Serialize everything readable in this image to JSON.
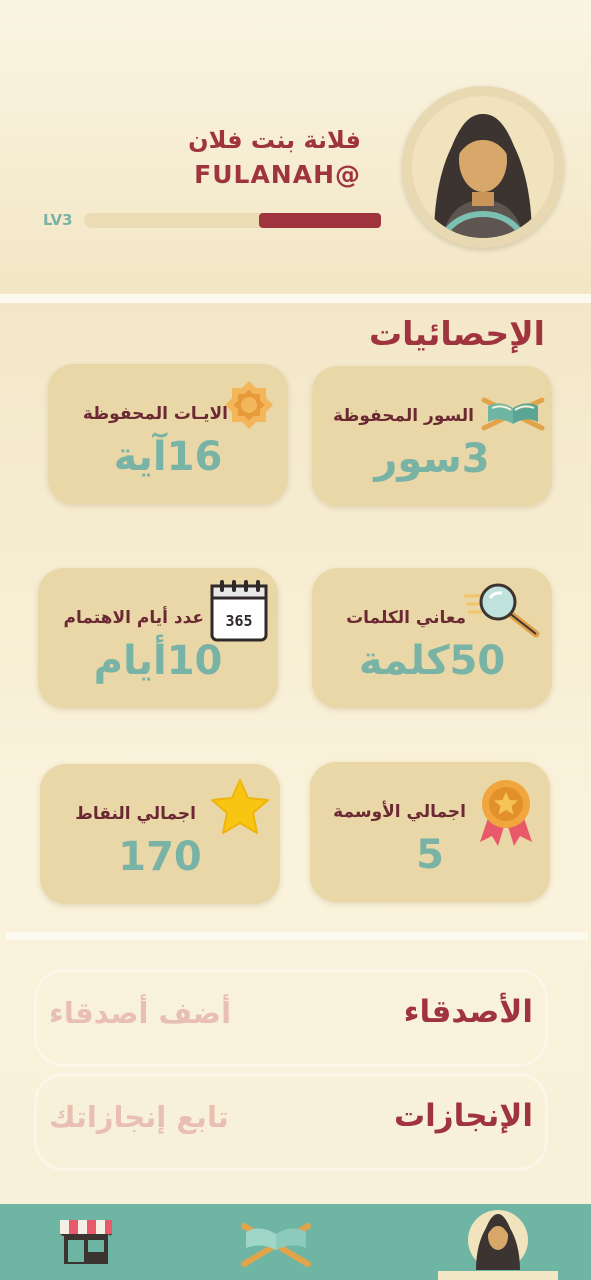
{
  "profile": {
    "name": "فلانة بنت فلان",
    "handle": "FULANAH@",
    "level_label": "LV3",
    "level_progress": 0.41
  },
  "stats": {
    "title": "الإحصائيات",
    "cards": [
      {
        "label": "السور المحفوظة",
        "value": "3سور",
        "icon": "open-quran-icon"
      },
      {
        "label": "الايـات المحفوظة",
        "value": "16آية",
        "icon": "eight-point-star-icon"
      },
      {
        "label": "معاني الكلمات",
        "value": "50كلمة",
        "icon": "magnifier-icon"
      },
      {
        "label": "عدد أيام الاهتمام",
        "value": "10أيام",
        "icon": "calendar-365-icon"
      },
      {
        "label": "اجمالي الأوسمة",
        "value": "5",
        "icon": "medal-icon"
      },
      {
        "label": "اجمالي النقاط",
        "value": "170",
        "icon": "star-icon"
      }
    ],
    "calendar_text": "365"
  },
  "friends": {
    "title": "الأصدقاء",
    "action": "أضف أصدقاء"
  },
  "achievements": {
    "title": "الإنجازات",
    "action": "تابع إنجازاتك"
  },
  "nav": {
    "items": [
      {
        "name": "store",
        "icon": "store-icon"
      },
      {
        "name": "quran",
        "icon": "quran-icon"
      },
      {
        "name": "profile",
        "icon": "profile-avatar-icon",
        "active": true
      }
    ]
  },
  "colors": {
    "accent": "#a0343e",
    "teal": "#78b3a6",
    "card": "#ead7a8",
    "nav": "#6eb5a4"
  }
}
